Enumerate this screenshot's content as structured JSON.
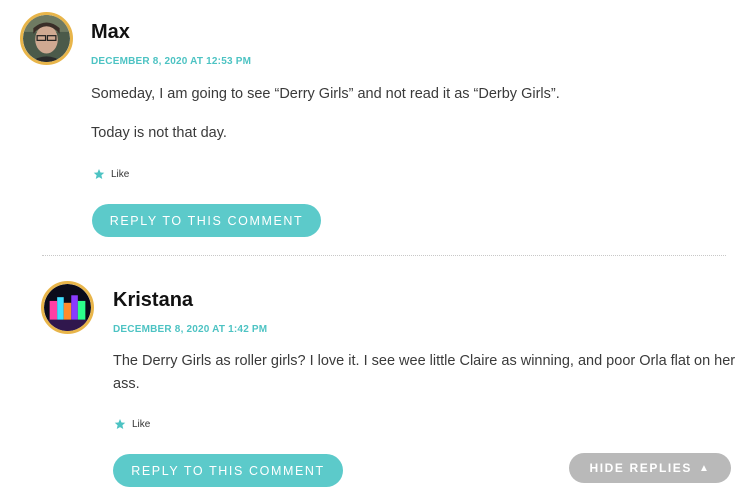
{
  "comments": [
    {
      "author": "Max",
      "date": "DECEMBER 8, 2020 AT 12:53 PM",
      "paragraphs": [
        "Someday, I am going to see “Derry Girls” and not read it as “Derby Girls”.",
        "Today is not that day."
      ],
      "like_label": "Like",
      "reply_label": "REPLY TO THIS COMMENT",
      "avatar_icon": "user-avatar-photo"
    },
    {
      "author": "Kristana",
      "date": "DECEMBER 8, 2020 AT 1:42 PM",
      "paragraphs": [
        "The Derry Girls as roller girls? I love it. I see wee little Claire as winning, and poor Orla flat on her",
        "ass."
      ],
      "like_label": "Like",
      "reply_label": "REPLY TO THIS COMMENT",
      "avatar_icon": "colorful-lights-avatar"
    }
  ],
  "hide_replies_label": "HIDE REPLIES",
  "colors": {
    "accent": "#5ccaca",
    "meta": "#4dc3c3",
    "avatar_border": "#e8b54a",
    "hide_bg": "#b9b9b9"
  }
}
